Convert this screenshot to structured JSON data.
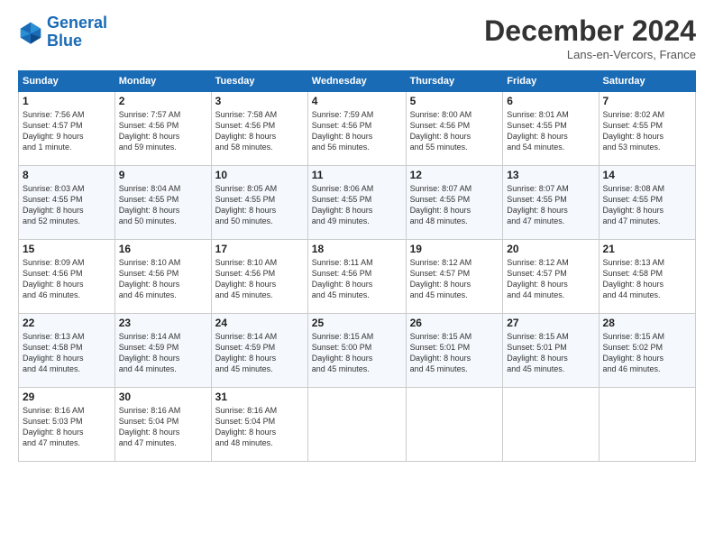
{
  "logo": {
    "line1": "General",
    "line2": "Blue"
  },
  "title": "December 2024",
  "location": "Lans-en-Vercors, France",
  "days_of_week": [
    "Sunday",
    "Monday",
    "Tuesday",
    "Wednesday",
    "Thursday",
    "Friday",
    "Saturday"
  ],
  "weeks": [
    [
      {
        "day": "1",
        "info": "Sunrise: 7:56 AM\nSunset: 4:57 PM\nDaylight: 9 hours\nand 1 minute."
      },
      {
        "day": "2",
        "info": "Sunrise: 7:57 AM\nSunset: 4:56 PM\nDaylight: 8 hours\nand 59 minutes."
      },
      {
        "day": "3",
        "info": "Sunrise: 7:58 AM\nSunset: 4:56 PM\nDaylight: 8 hours\nand 58 minutes."
      },
      {
        "day": "4",
        "info": "Sunrise: 7:59 AM\nSunset: 4:56 PM\nDaylight: 8 hours\nand 56 minutes."
      },
      {
        "day": "5",
        "info": "Sunrise: 8:00 AM\nSunset: 4:56 PM\nDaylight: 8 hours\nand 55 minutes."
      },
      {
        "day": "6",
        "info": "Sunrise: 8:01 AM\nSunset: 4:55 PM\nDaylight: 8 hours\nand 54 minutes."
      },
      {
        "day": "7",
        "info": "Sunrise: 8:02 AM\nSunset: 4:55 PM\nDaylight: 8 hours\nand 53 minutes."
      }
    ],
    [
      {
        "day": "8",
        "info": "Sunrise: 8:03 AM\nSunset: 4:55 PM\nDaylight: 8 hours\nand 52 minutes."
      },
      {
        "day": "9",
        "info": "Sunrise: 8:04 AM\nSunset: 4:55 PM\nDaylight: 8 hours\nand 50 minutes."
      },
      {
        "day": "10",
        "info": "Sunrise: 8:05 AM\nSunset: 4:55 PM\nDaylight: 8 hours\nand 50 minutes."
      },
      {
        "day": "11",
        "info": "Sunrise: 8:06 AM\nSunset: 4:55 PM\nDaylight: 8 hours\nand 49 minutes."
      },
      {
        "day": "12",
        "info": "Sunrise: 8:07 AM\nSunset: 4:55 PM\nDaylight: 8 hours\nand 48 minutes."
      },
      {
        "day": "13",
        "info": "Sunrise: 8:07 AM\nSunset: 4:55 PM\nDaylight: 8 hours\nand 47 minutes."
      },
      {
        "day": "14",
        "info": "Sunrise: 8:08 AM\nSunset: 4:55 PM\nDaylight: 8 hours\nand 47 minutes."
      }
    ],
    [
      {
        "day": "15",
        "info": "Sunrise: 8:09 AM\nSunset: 4:56 PM\nDaylight: 8 hours\nand 46 minutes."
      },
      {
        "day": "16",
        "info": "Sunrise: 8:10 AM\nSunset: 4:56 PM\nDaylight: 8 hours\nand 46 minutes."
      },
      {
        "day": "17",
        "info": "Sunrise: 8:10 AM\nSunset: 4:56 PM\nDaylight: 8 hours\nand 45 minutes."
      },
      {
        "day": "18",
        "info": "Sunrise: 8:11 AM\nSunset: 4:56 PM\nDaylight: 8 hours\nand 45 minutes."
      },
      {
        "day": "19",
        "info": "Sunrise: 8:12 AM\nSunset: 4:57 PM\nDaylight: 8 hours\nand 45 minutes."
      },
      {
        "day": "20",
        "info": "Sunrise: 8:12 AM\nSunset: 4:57 PM\nDaylight: 8 hours\nand 44 minutes."
      },
      {
        "day": "21",
        "info": "Sunrise: 8:13 AM\nSunset: 4:58 PM\nDaylight: 8 hours\nand 44 minutes."
      }
    ],
    [
      {
        "day": "22",
        "info": "Sunrise: 8:13 AM\nSunset: 4:58 PM\nDaylight: 8 hours\nand 44 minutes."
      },
      {
        "day": "23",
        "info": "Sunrise: 8:14 AM\nSunset: 4:59 PM\nDaylight: 8 hours\nand 44 minutes."
      },
      {
        "day": "24",
        "info": "Sunrise: 8:14 AM\nSunset: 4:59 PM\nDaylight: 8 hours\nand 45 minutes."
      },
      {
        "day": "25",
        "info": "Sunrise: 8:15 AM\nSunset: 5:00 PM\nDaylight: 8 hours\nand 45 minutes."
      },
      {
        "day": "26",
        "info": "Sunrise: 8:15 AM\nSunset: 5:01 PM\nDaylight: 8 hours\nand 45 minutes."
      },
      {
        "day": "27",
        "info": "Sunrise: 8:15 AM\nSunset: 5:01 PM\nDaylight: 8 hours\nand 45 minutes."
      },
      {
        "day": "28",
        "info": "Sunrise: 8:15 AM\nSunset: 5:02 PM\nDaylight: 8 hours\nand 46 minutes."
      }
    ],
    [
      {
        "day": "29",
        "info": "Sunrise: 8:16 AM\nSunset: 5:03 PM\nDaylight: 8 hours\nand 47 minutes."
      },
      {
        "day": "30",
        "info": "Sunrise: 8:16 AM\nSunset: 5:04 PM\nDaylight: 8 hours\nand 47 minutes."
      },
      {
        "day": "31",
        "info": "Sunrise: 8:16 AM\nSunset: 5:04 PM\nDaylight: 8 hours\nand 48 minutes."
      },
      {
        "day": "",
        "info": ""
      },
      {
        "day": "",
        "info": ""
      },
      {
        "day": "",
        "info": ""
      },
      {
        "day": "",
        "info": ""
      }
    ]
  ]
}
